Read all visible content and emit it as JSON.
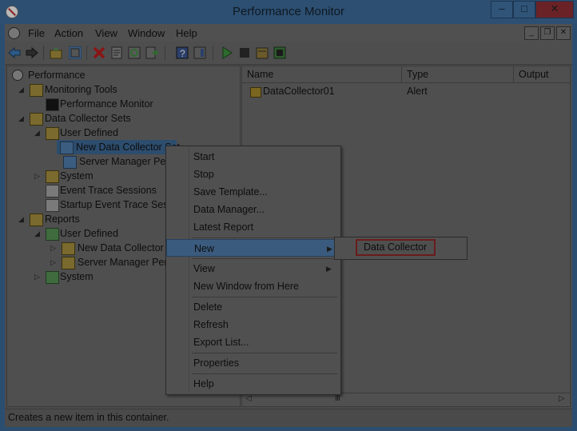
{
  "window": {
    "title": "Performance Monitor",
    "min": "–",
    "max": "□",
    "close": "✕"
  },
  "menu": [
    "File",
    "Action",
    "View",
    "Window",
    "Help"
  ],
  "mdi": {
    "min": "_",
    "restore": "❐",
    "close": "✕"
  },
  "tree": {
    "performance": "Performance",
    "monitoring_tools": "Monitoring Tools",
    "performance_monitor": "Performance Monitor",
    "data_collector_sets": "Data Collector Sets",
    "user_defined": "User Defined",
    "new_dcs": "New Data Collector Set",
    "server_manager_perf": "Server Manager Perfor",
    "system": "System",
    "event_trace": "Event Trace Sessions",
    "startup_trace": "Startup Event Trace Sessio",
    "reports": "Reports",
    "reports_user_defined": "User Defined",
    "reports_new_dcs": "New Data Collector Se",
    "reports_server_manager": "Server Manager Perfor",
    "reports_system": "System"
  },
  "list": {
    "columns": [
      "Name",
      "Type",
      "Output"
    ],
    "rows": [
      {
        "name": "DataCollector01",
        "type": "Alert"
      }
    ]
  },
  "context_menu": {
    "items": [
      "Start",
      "Stop",
      "Save Template...",
      "Data Manager...",
      "Latest Report",
      "New",
      "View",
      "New Window from Here",
      "Delete",
      "Refresh",
      "Export List...",
      "Properties",
      "Help"
    ]
  },
  "submenu": {
    "item": "Data Collector"
  },
  "status": "Creates a new item in this container.",
  "icons": {
    "back": "arrow-left-icon",
    "forward": "arrow-right-icon",
    "delete": "red-x-icon",
    "start": "play-icon",
    "stop": "stop-icon"
  },
  "colors": {
    "accent": "#2d4d6e",
    "highlight_border": "#6b1b1b",
    "play": "#2e7d32",
    "delete": "#a01010"
  }
}
